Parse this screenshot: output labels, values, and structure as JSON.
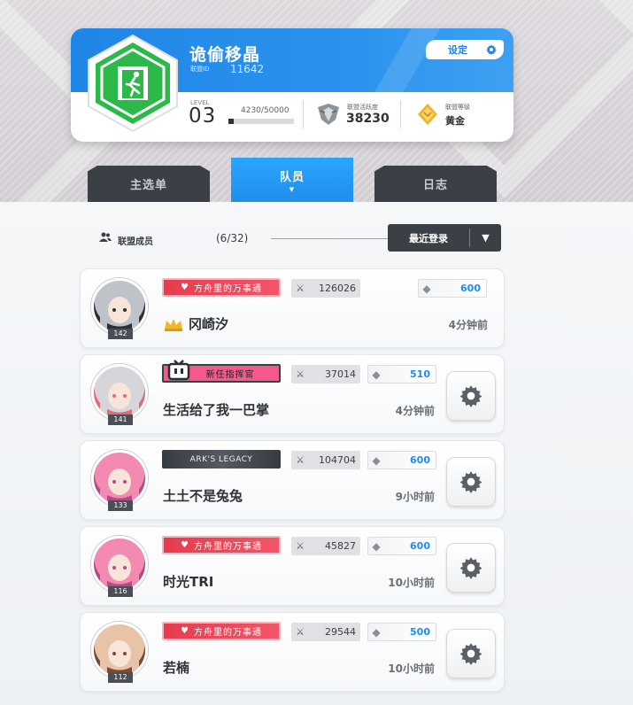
{
  "profile": {
    "name": "诡偷移晶",
    "id_label": "联盟ID",
    "id_value": "11642",
    "settings_label": "设定",
    "level_label": "LEVEL",
    "level_value": "03",
    "exp_text": "4230/50000",
    "exp_progress": 0.0846,
    "activity_label": "联盟活跃度",
    "activity_value": "38230",
    "rank_label": "联盟等级",
    "rank_value": "黄金",
    "badge_color": "#2db84a"
  },
  "tabs": [
    {
      "label": "主选单",
      "active": false
    },
    {
      "label": "队员",
      "active": true,
      "indicator": "▼"
    },
    {
      "label": "日志",
      "active": false
    }
  ],
  "members_header": {
    "label": "联盟成员",
    "count": "(6/32)",
    "sort_label": "最近登录",
    "sort_caret": "▼"
  },
  "members": [
    {
      "avatar_level": "142",
      "title": "方舟里的万事通",
      "title_style": "red",
      "power": "126026",
      "contribution": "600",
      "name": "冈崎汐",
      "crowned": true,
      "last_login": "4分钟前",
      "has_gear": false,
      "avatar_colors": [
        "#bfc3c9",
        "#2d2f33"
      ]
    },
    {
      "avatar_level": "141",
      "title": "新任指挥官",
      "title_style": "pink",
      "power": "37014",
      "contribution": "510",
      "name": "生活给了我一巴掌",
      "crowned": false,
      "last_login": "4分钟前",
      "has_gear": true,
      "avatar_colors": [
        "#d6d6da",
        "#e06a7a"
      ]
    },
    {
      "avatar_level": "133",
      "title": "ARK'S LEGACY",
      "title_style": "dark",
      "power": "104704",
      "contribution": "600",
      "name": "土土不是兔兔",
      "crowned": false,
      "last_login": "9小时前",
      "has_gear": true,
      "avatar_colors": [
        "#f28ab2",
        "#b44a86"
      ]
    },
    {
      "avatar_level": "116",
      "title": "方舟里的万事通",
      "title_style": "red",
      "power": "45827",
      "contribution": "600",
      "name": "时光TRI",
      "crowned": false,
      "last_login": "10小时前",
      "has_gear": true,
      "avatar_colors": [
        "#f28ab2",
        "#b44a86"
      ]
    },
    {
      "avatar_level": "112",
      "title": "方舟里的万事通",
      "title_style": "red",
      "power": "29544",
      "contribution": "500",
      "name": "若楠",
      "crowned": false,
      "last_login": "10小时前",
      "has_gear": true,
      "avatar_colors": [
        "#e8c3a8",
        "#7a4a36"
      ]
    }
  ]
}
